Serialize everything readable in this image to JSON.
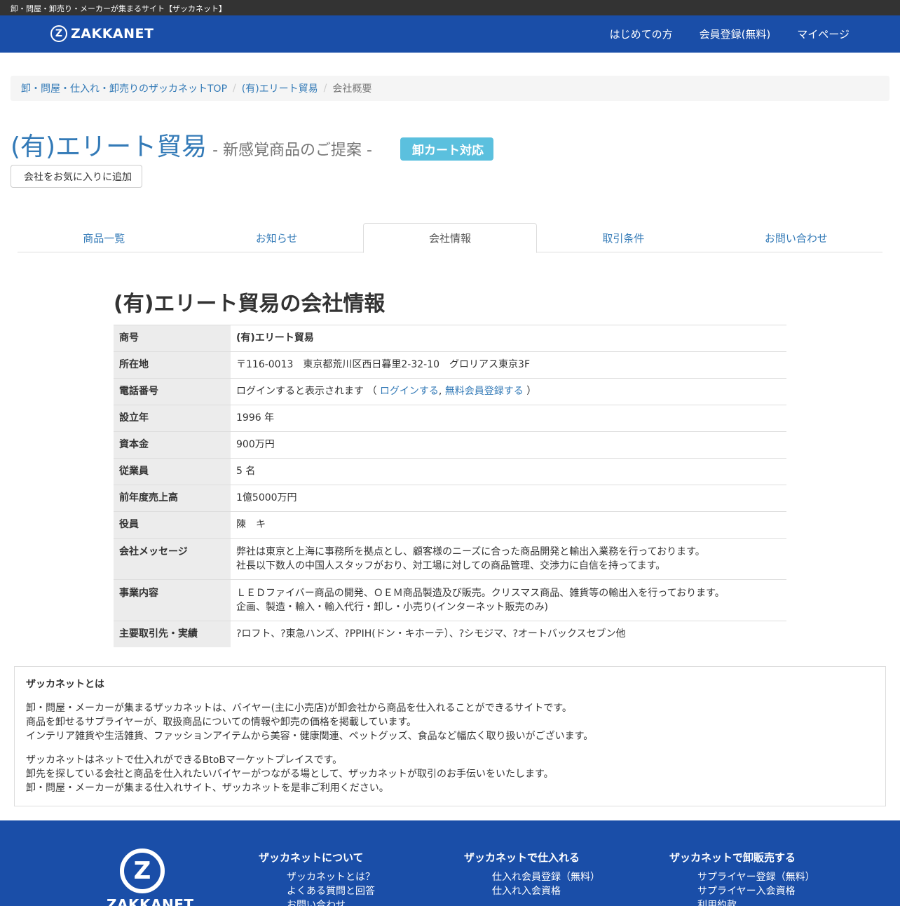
{
  "topbar": {
    "text": "卸・問屋・卸売り・メーカーが集まるサイト【ザッカネット】"
  },
  "header": {
    "logo_mark": "Z",
    "logo_text": "ZAKKANET",
    "nav": [
      {
        "icon": "",
        "label": "はじめての方"
      },
      {
        "icon": "",
        "label": "会員登録(無料)"
      },
      {
        "icon": "",
        "label": "マイページ"
      }
    ]
  },
  "breadcrumb": {
    "items": [
      "卸・問屋・仕入れ・卸売りのザッカネットTOP",
      "(有)エリート貿易"
    ],
    "current": "会社概要",
    "separator": "/"
  },
  "company": {
    "name": "(有)エリート貿易",
    "catch": "- 新感覚商品のご提案 -",
    "badge_icon": "",
    "badge": "卸カート対応",
    "fav_icon": "",
    "fav_label": "会社をお気に入りに追加"
  },
  "tabs": [
    "商品一覧",
    "お知らせ",
    "会社情報",
    "取引条件",
    "お問い合わせ"
  ],
  "info": {
    "title": "(有)エリート貿易の会社情報",
    "rows": {
      "name": {
        "label": "商号",
        "value": "(有)エリート貿易"
      },
      "address": {
        "label": "所在地",
        "value": "〒116-0013　東京都荒川区西日暮里2-32-10　グロリアス東京3F"
      },
      "phone": {
        "label": "電話番号",
        "text": "ログインすると表示されます （",
        "login": "ログインする",
        "comma": ",",
        "register": "無料会員登録する",
        "close": "）"
      },
      "founded": {
        "label": "設立年",
        "value": "1996 年"
      },
      "capital": {
        "label": "資本金",
        "value": "900万円"
      },
      "employees": {
        "label": "従業員",
        "value": "5 名"
      },
      "sales": {
        "label": "前年度売上高",
        "value": "1億5000万円"
      },
      "officers": {
        "label": "役員",
        "value": "陳　キ"
      },
      "message": {
        "label": "会社メッセージ",
        "line1": "弊社は東京と上海に事務所を拠点とし、顧客様のニーズに合った商品開発と輸出入業務を行っております。",
        "line2": "社長以下数人の中国人スタッフがおり、対工場に対しての商品管理、交渉力に自信を持ってます。"
      },
      "business": {
        "label": "事業内容",
        "line1": "ＬＥＤファイバー商品の開発、ＯＥＭ商品製造及び販売。クリスマス商品、雑貨等の輸出入を行っております。",
        "line2": "企画、製造・輸入・輸入代行・卸し・小売り(インターネット販売のみ)"
      },
      "clients": {
        "label": "主要取引先・実績",
        "value": "?ロフト、?東急ハンズ、?PPIH(ドン・キホーテ）、?シモジマ、?オートバックスセブン他"
      }
    }
  },
  "about": {
    "title": "ザッカネットとは",
    "p1": [
      "卸・問屋・メーカーが集まるザッカネットは、バイヤー(主に小売店)が卸会社から商品を仕入れることができるサイトです。",
      "商品を卸せるサプライヤーが、取扱商品についての情報や卸売の価格を掲載しています。",
      "インテリア雑貨や生活雑貨、ファッションアイテムから美容・健康関連、ペットグッズ、食品など幅広く取り扱いがございます。"
    ],
    "p2": [
      "ザッカネットはネットで仕入れができるBtoBマーケットプレイスです。",
      "卸先を探している会社と商品を仕入れたいバイヤーがつながる場として、ザッカネットが取引のお手伝いをいたします。",
      "卸・問屋・メーカーが集まる仕入れサイト、ザッカネットを是非ご利用ください。"
    ]
  },
  "footer": {
    "logo_mark": "Z",
    "logo_text": "ZAKKANET",
    "col1": {
      "title": "ザッカネットについて",
      "links": [
        "ザッカネットとは？",
        "よくある質問と回答",
        "お問い合わせ"
      ]
    },
    "col2": {
      "title": "ザッカネットで仕入れる",
      "links": [
        "仕入れ会員登録（無料）",
        "仕入れ入会資格"
      ]
    },
    "col3": {
      "title": "ザッカネットで卸販売する",
      "links": [
        "サプライヤー登録（無料）",
        "サプライヤー入会資格",
        "利用約款"
      ]
    }
  }
}
